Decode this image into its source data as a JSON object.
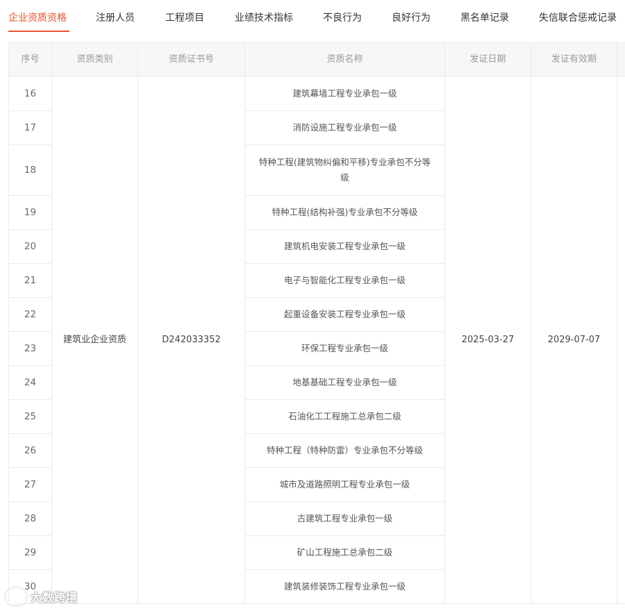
{
  "tabs": [
    {
      "label": "企业资质资格",
      "active": true
    },
    {
      "label": "注册人员"
    },
    {
      "label": "工程项目"
    },
    {
      "label": "业绩技术指标"
    },
    {
      "label": "不良行为"
    },
    {
      "label": "良好行为"
    },
    {
      "label": "黑名单记录"
    },
    {
      "label": "失信联合惩戒记录"
    }
  ],
  "table": {
    "headers": {
      "index": "序号",
      "category": "资质类别",
      "cert_no": "资质证书号",
      "name": "资质名称",
      "issue_date": "发证日期",
      "valid_until": "发证有效期"
    },
    "category": "建筑业企业资质",
    "cert_no": "D242033352",
    "issue_date": "2025-03-27",
    "valid_until": "2029-07-07",
    "rows": [
      {
        "index": "16",
        "name": "建筑幕墙工程专业承包一级"
      },
      {
        "index": "17",
        "name": "消防设施工程专业承包一级"
      },
      {
        "index": "18",
        "name": "特种工程(建筑物纠偏和平移)专业承包不分等级"
      },
      {
        "index": "19",
        "name": "特种工程(结构补强)专业承包不分等级"
      },
      {
        "index": "20",
        "name": "建筑机电安装工程专业承包一级"
      },
      {
        "index": "21",
        "name": "电子与智能化工程专业承包一级"
      },
      {
        "index": "22",
        "name": "起重设备安装工程专业承包一级"
      },
      {
        "index": "23",
        "name": "环保工程专业承包一级"
      },
      {
        "index": "24",
        "name": "地基基础工程专业承包一级"
      },
      {
        "index": "25",
        "name": "石油化工工程施工总承包二级"
      },
      {
        "index": "26",
        "name": "特种工程（特种防雷）专业承包不分等级"
      },
      {
        "index": "27",
        "name": "城市及道路照明工程专业承包一级"
      },
      {
        "index": "28",
        "name": "古建筑工程专业承包一级"
      },
      {
        "index": "29",
        "name": "矿山工程施工总承包二级"
      },
      {
        "index": "30",
        "name": "建筑装修装饰工程专业承包一级"
      }
    ]
  },
  "watermark": {
    "text": "大数跨境"
  },
  "colors": {
    "accent": "#e8542e",
    "header_bg": "#f7f7f7",
    "border": "#ebebeb"
  }
}
